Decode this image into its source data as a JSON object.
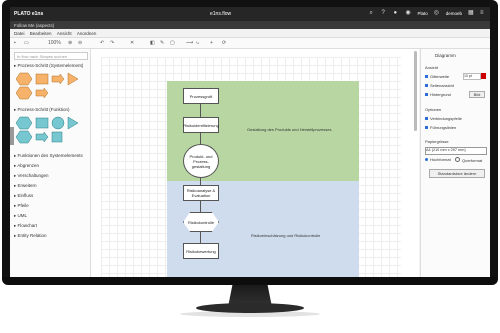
{
  "app": {
    "brand": "PLATO e1ns",
    "file_title": "e1ns.flow",
    "user": "Plato",
    "workspace": "demoeb"
  },
  "tab": {
    "title": "Follow Me (aspects)"
  },
  "menu": [
    "Datei",
    "Bearbeiten",
    "Ansicht",
    "Anordnen"
  ],
  "toolbar": {
    "zoom": "100%"
  },
  "left_panel": {
    "search_placeholder": "In flow nach Shapes suchen",
    "sections": [
      "Prozess-Schritt (Systemelement)",
      "Prozess-Schritt (Funktion)",
      "Funktionen des Systemelements",
      "Abgrenzen",
      "Verschaltungen",
      "Erweitern",
      "Einfluss",
      "Pfeile",
      "UML",
      "Flowchart",
      "Entity Relation"
    ]
  },
  "diagram": {
    "lane_green_label": "Gestaltung des Produkts und Herstellprozesses",
    "lane_blue_label": "Risikoeinschätzung und Risikokontrolle",
    "nodes": {
      "n1": "Prozessgruft",
      "n2": "Risikoidentifizierung",
      "n3": "Produkt- und Prozess-gestaltung",
      "n4": "Risikoanalyse & Evaluation",
      "n5": "Risikokontrolle",
      "n6": "Risikobewertung"
    }
  },
  "right_panel": {
    "title": "Diagramm",
    "ansicht_label": "Ansicht",
    "gitterweite_label": "Gitterweite",
    "gitterweite_value": "10 pt",
    "seitenansicht_label": "Seitenansicht",
    "hintergrund_label": "Hintergrund",
    "bild_label": "Bild",
    "optionen_label": "Optionen",
    "verbindungspfeile_label": "Verbindungspfeile",
    "fuehrungslinien_label": "Führungslinien",
    "papiergroesse_label": "Papiergrösse",
    "papierformat": "A4 (210 mm x 297 mm)",
    "hochformat": "Hochformat",
    "querformat": "Querformat",
    "standard_button": "Standardstore ändern"
  }
}
